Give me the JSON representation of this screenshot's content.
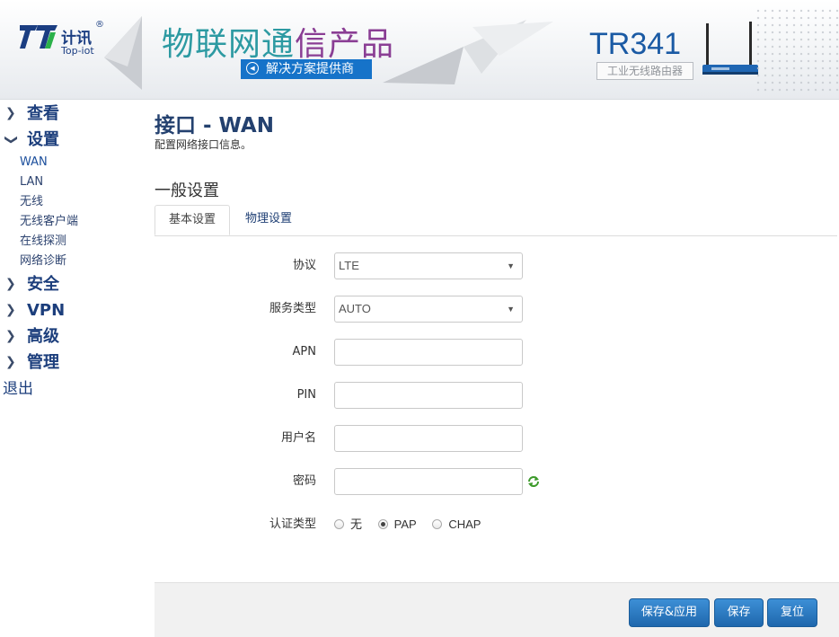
{
  "header": {
    "logo_cn": "计讯",
    "logo_reg": "®",
    "logo_en": "Top-iot",
    "slogan_part1": "物联网通",
    "slogan_part2": "信",
    "slogan_part3": "产品",
    "slogan_sub": "解决方案提供商",
    "model": "TR341",
    "model_sub": "工业无线路由器"
  },
  "menu": {
    "view": "查看",
    "settings": "设置",
    "sub_items": [
      "WAN",
      "LAN",
      "无线",
      "无线客户端",
      "在线探测",
      "网络诊断"
    ],
    "security": "安全",
    "vpn": "VPN",
    "advanced": "高级",
    "manage": "管理",
    "logout": "退出"
  },
  "page": {
    "title": "接口 - WAN",
    "description": "配置网络接口信息。",
    "section_title": "一般设置",
    "tabs": [
      "基本设置",
      "物理设置"
    ]
  },
  "form": {
    "protocol_label": "协议",
    "protocol_value": "LTE",
    "service_label": "服务类型",
    "service_value": "AUTO",
    "apn_label": "APN",
    "apn_value": "",
    "pin_label": "PIN",
    "pin_value": "",
    "username_label": "用户名",
    "username_value": "",
    "password_label": "密码",
    "password_value": "",
    "auth_label": "认证类型",
    "auth_options": [
      "无",
      "PAP",
      "CHAP"
    ],
    "auth_selected": "PAP"
  },
  "actions": {
    "save_apply": "保存&应用",
    "save": "保存",
    "reset": "复位"
  },
  "colors": {
    "brand_blue": "#1c3e7c",
    "button_blue": "#2a78c2",
    "slogan_teal": "#2d9aa2",
    "slogan_purple": "#8a3e94"
  }
}
